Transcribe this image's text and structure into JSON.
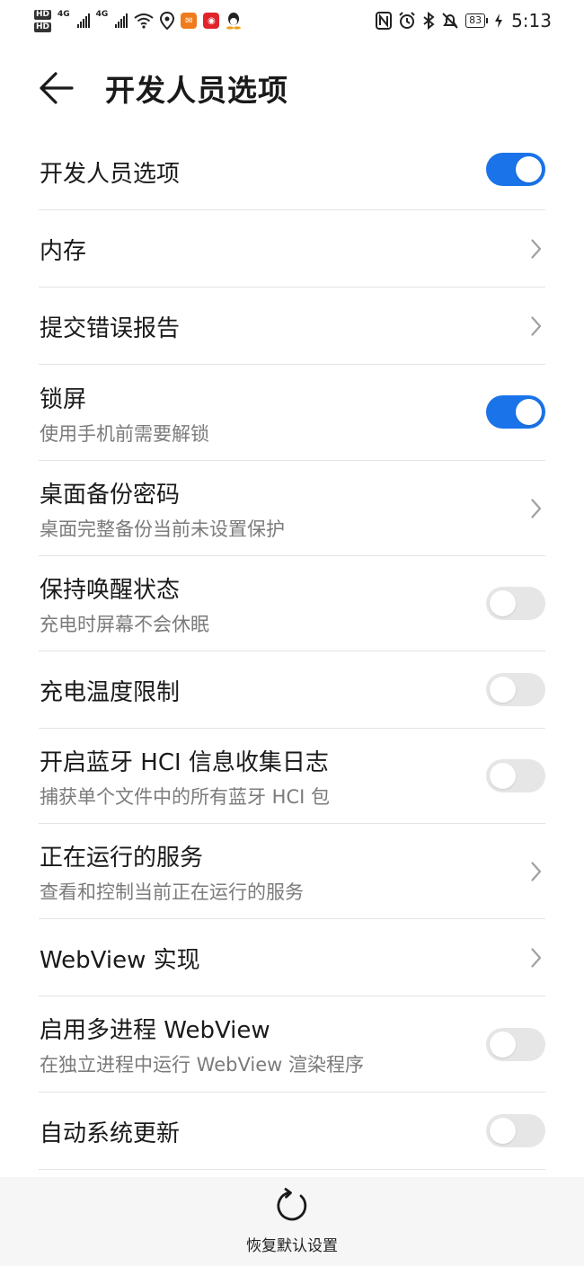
{
  "status_bar": {
    "hd1": "HD",
    "hd2": "HD",
    "net1": "4G",
    "net2": "4G",
    "battery": "83",
    "time": "5:13"
  },
  "header": {
    "title": "开发人员选项"
  },
  "items": [
    {
      "title": "开发人员选项",
      "control": "toggle",
      "on": true
    },
    {
      "title": "内存",
      "control": "chevron"
    },
    {
      "title": "提交错误报告",
      "control": "chevron"
    },
    {
      "title": "锁屏",
      "subtitle": "使用手机前需要解锁",
      "control": "toggle",
      "on": true
    },
    {
      "title": "桌面备份密码",
      "subtitle": "桌面完整备份当前未设置保护",
      "control": "chevron"
    },
    {
      "title": "保持唤醒状态",
      "subtitle": "充电时屏幕不会休眠",
      "control": "toggle",
      "on": false
    },
    {
      "title": "充电温度限制",
      "control": "toggle",
      "on": false
    },
    {
      "title": "开启蓝牙 HCI 信息收集日志",
      "subtitle": "捕获单个文件中的所有蓝牙 HCI 包",
      "control": "toggle",
      "on": false
    },
    {
      "title": "正在运行的服务",
      "subtitle": "查看和控制当前正在运行的服务",
      "control": "chevron"
    },
    {
      "title": "WebView 实现",
      "control": "chevron"
    },
    {
      "title": "启用多进程 WebView",
      "subtitle": "在独立进程中运行 WebView 渲染程序",
      "control": "toggle",
      "on": false
    },
    {
      "title": "自动系统更新",
      "control": "toggle",
      "on": false
    }
  ],
  "footer": {
    "reset_label": "恢复默认设置"
  },
  "colors": {
    "accent": "#1a73e8",
    "toggle_off": "#e6e6e6",
    "divider": "#e3e3e3",
    "secondary_text": "#7b7b7b"
  },
  "icons": {
    "back": "arrow-left-icon",
    "chevron": "chevron-right-icon",
    "reset": "refresh-icon"
  }
}
